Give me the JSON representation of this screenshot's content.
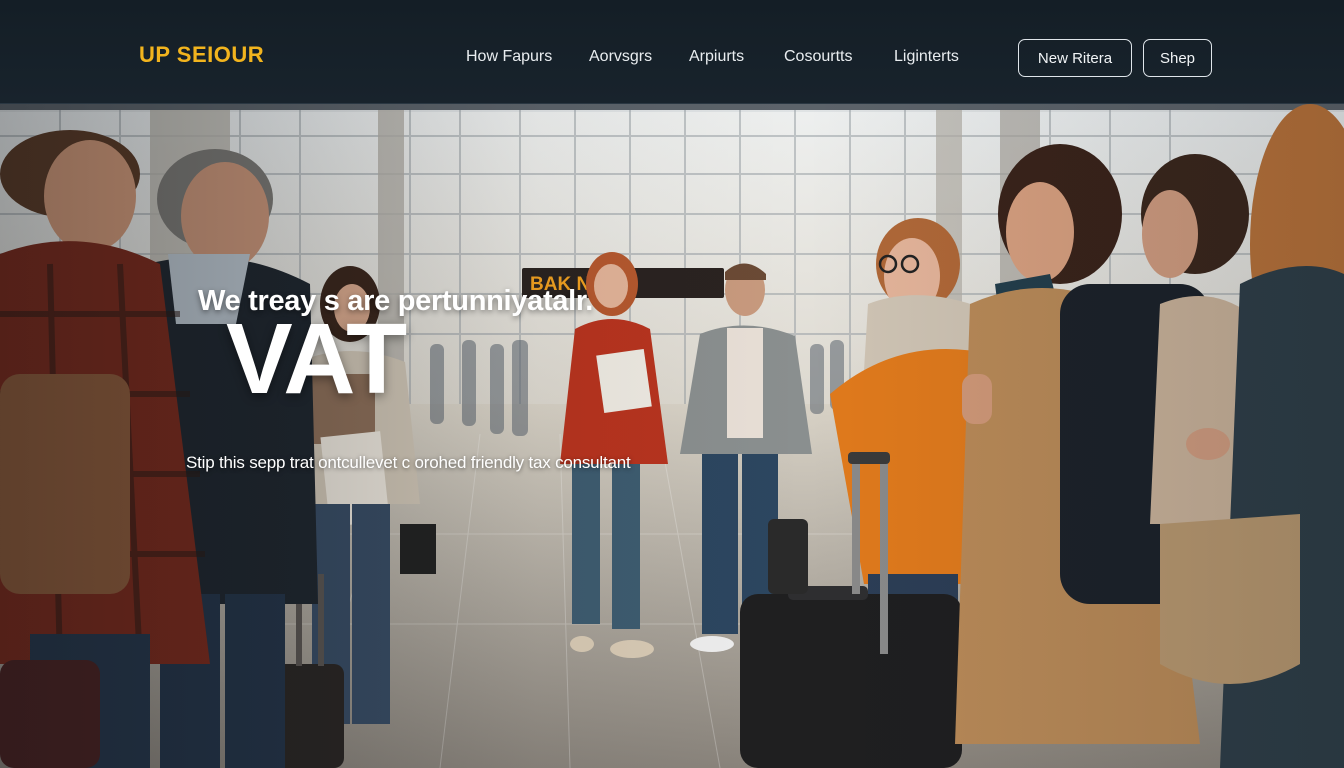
{
  "brand": {
    "logo_text": "UP SEIOUR"
  },
  "nav": {
    "links": [
      "How Fapurs",
      "Aorvsgrs",
      "Arpiurts",
      "Cosourtts",
      "Liginterts"
    ],
    "buttons": {
      "primary": "New Ritera",
      "secondary": "Shep"
    }
  },
  "hero": {
    "kicker": "We treay s are pertunniyatalr.",
    "title": "VAT",
    "subtitle": "Stip this sepp trat ontcullevet c orohed friendly tax consultant",
    "sign_text": "BAK    NTE ▸"
  },
  "colors": {
    "navbar_bg": "#141e26",
    "logo": "#f2b41e",
    "nav_text": "#e9edf0",
    "hero_text": "#ffffff"
  }
}
